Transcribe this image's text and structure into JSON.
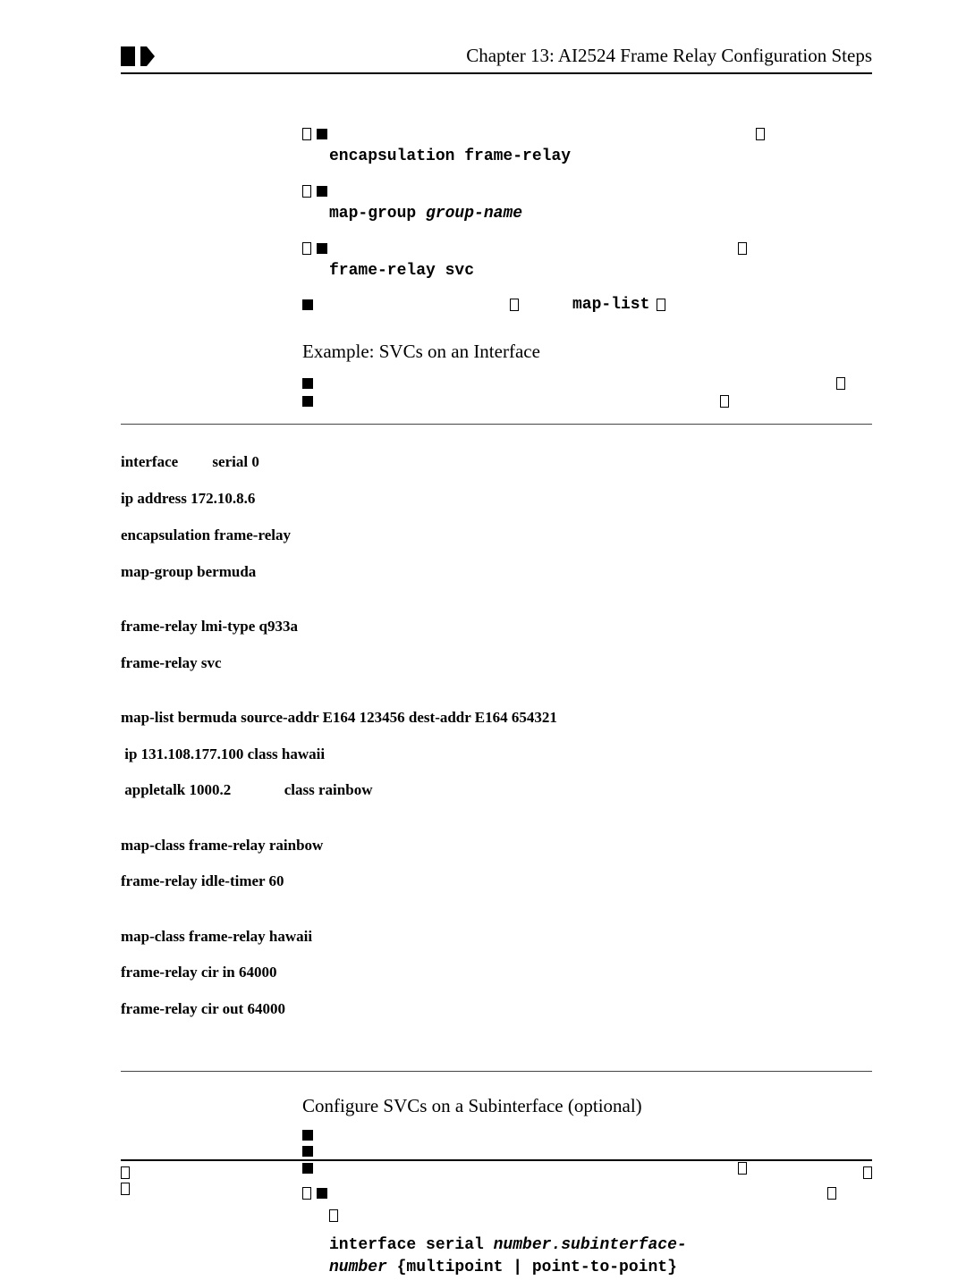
{
  "header": {
    "title": "Chapter 13: AI2524 Frame Relay Configuration Steps"
  },
  "step2": {
    "cmd": "encapsulation frame-relay"
  },
  "step3": {
    "cmd_prefix": "map-group ",
    "cmd_arg": "group-name"
  },
  "step4": {
    "cmd": "frame-relay svc"
  },
  "step5": {
    "maplist": "map-list"
  },
  "example_title": "Example: SVCs on an Interface",
  "config_lines": {
    "l1": "interface         serial 0",
    "l2": "ip address 172.10.8.6",
    "l3": "encapsulation frame-relay",
    "l4": "map-group bermuda",
    "l5": "",
    "l6": "frame-relay lmi-type q933a",
    "l7": "frame-relay svc",
    "l8": "",
    "l9": "map-list bermuda source-addr E164 123456 dest-addr E164 654321",
    "l10": " ip 131.108.177.100 class hawaii",
    "l11": " appletalk 1000.2              class rainbow",
    "l12": "",
    "l13": "map-class frame-relay rainbow",
    "l14": "frame-relay idle-timer 60",
    "l15": "",
    "l16": "map-class frame-relay hawaii",
    "l17": "frame-relay cir in 64000",
    "l18": "frame-relay cir out 64000"
  },
  "subsection_title": "Configure SVCs on a Subinterface (optional)",
  "cmd_interface": {
    "prefix": "interface serial ",
    "arg1": "number.subinterface-",
    "arg2": "number",
    "suffix": " {multipoint | point-to-point}"
  }
}
